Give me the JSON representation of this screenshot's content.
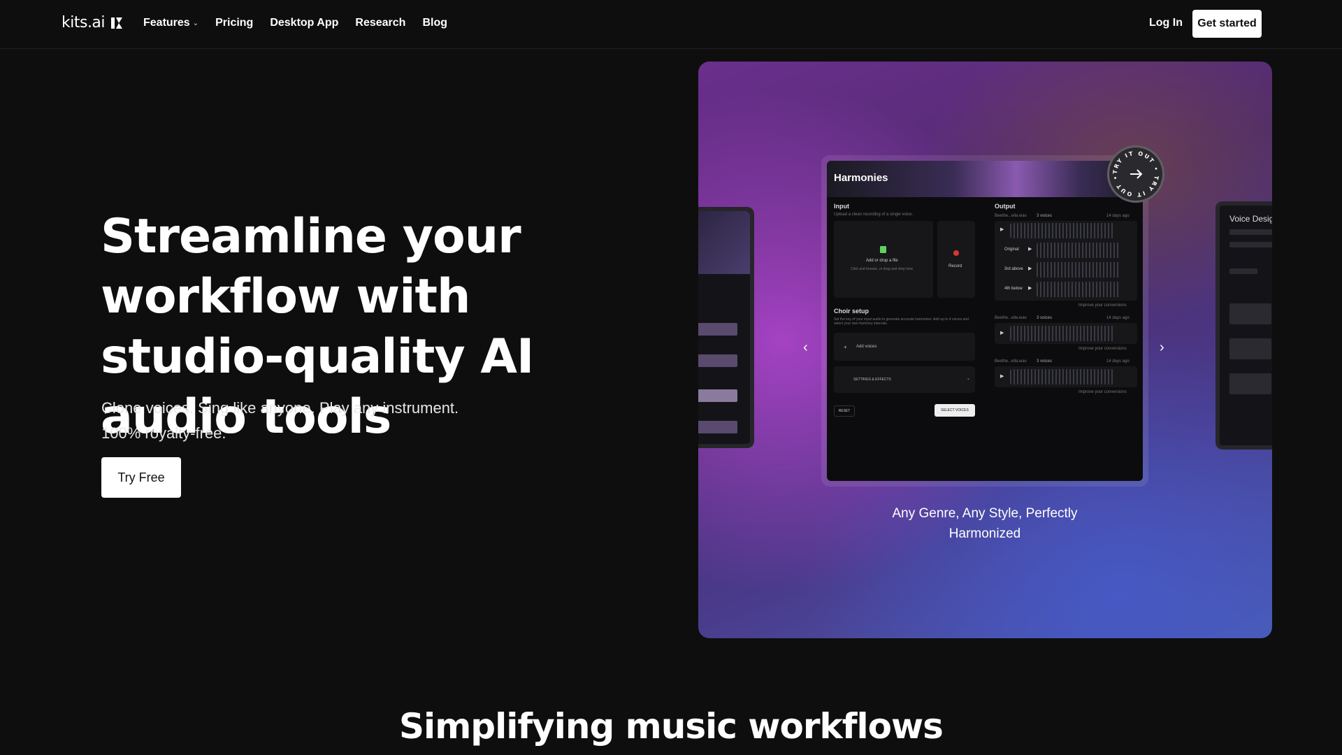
{
  "nav": {
    "logo_text": "kits.ai",
    "links": [
      {
        "label": "Features",
        "has_dropdown": true
      },
      {
        "label": "Pricing"
      },
      {
        "label": "Desktop App"
      },
      {
        "label": "Research"
      },
      {
        "label": "Blog"
      }
    ],
    "login": "Log In",
    "cta": "Get started"
  },
  "hero": {
    "title": "Streamline your workflow with studio-quality AI audio tools",
    "subtitle_line1": "Clone voices. Sing like anyone. Play any instrument.",
    "subtitle_line2": "100% royalty-free.",
    "cta": "Try Free"
  },
  "showcase": {
    "badge_text": "TRY IT OUT • TRY IT OUT •",
    "caption_line1": "Any Genre, Any Style, Perfectly",
    "caption_line2": "Harmonized",
    "right_card_title": "Voice Design",
    "app": {
      "title": "Harmonies",
      "input_label": "Input",
      "input_hint": "Upload a clean recording of a single voice.",
      "drop_label": "Add or drop a file",
      "drop_hint": "Click and browse, or drag and drop here",
      "record_label": "Record",
      "choir_label": "Choir setup",
      "choir_hint": "Set the key of your input audio to generate accurate harmonies. Add up to 4 voices and select your own harmony intervals.",
      "add_voices": "Add voices",
      "settings": "SETTINGS & EFFECTS",
      "reset": "RESET",
      "select_voices": "SELECT VOICES",
      "output_label": "Output",
      "output_groups": [
        {
          "file": "Beethe...ella.wav",
          "voices": "3 voices",
          "time": "14 days ago",
          "tracks": [
            "Original",
            "3rd above",
            "4th below"
          ]
        },
        {
          "file": "Beethe...ella.wav",
          "voices": "3 voices",
          "time": "14 days ago",
          "tracks": []
        },
        {
          "file": "Beethe...ella.wav",
          "voices": "3 voices",
          "time": "14 days ago",
          "tracks": []
        }
      ],
      "improve": "Improve your conversions"
    }
  },
  "section": {
    "title": "Simplifying music workflows"
  },
  "colors": {
    "background": "#0e0e0e",
    "gradient_purple": "#6a2f8c",
    "gradient_blue": "#4a5cb0"
  }
}
